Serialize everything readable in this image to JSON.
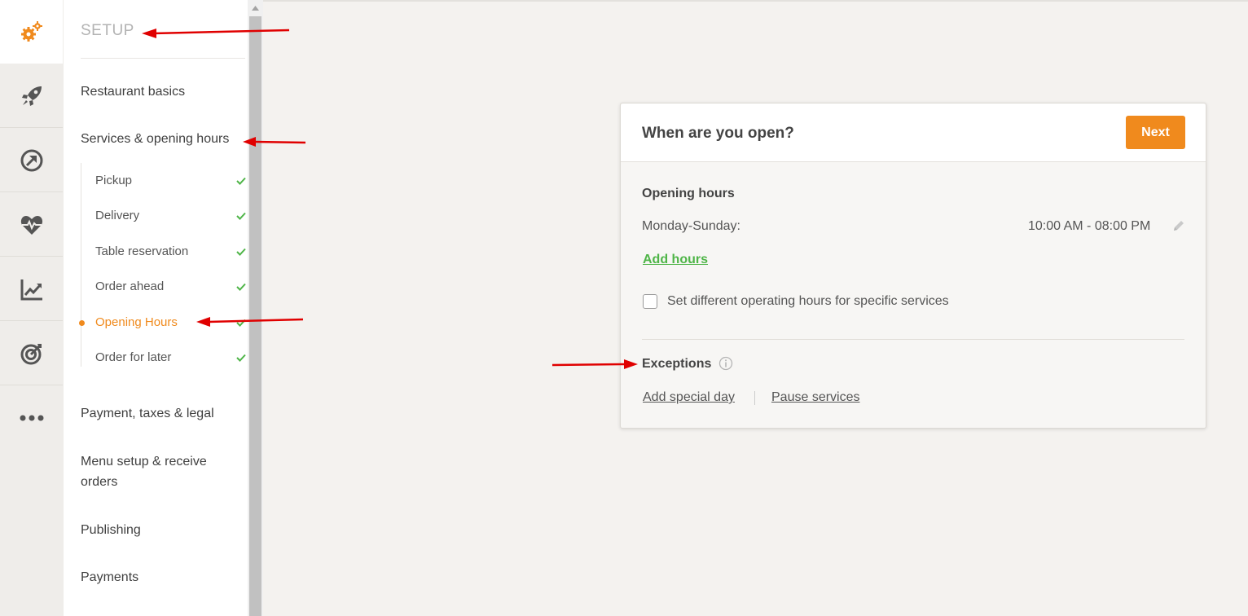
{
  "rail": {
    "items": [
      {
        "icon": "gears-icon",
        "active": true
      },
      {
        "icon": "rocket-icon"
      },
      {
        "icon": "promote-arrow-icon"
      },
      {
        "icon": "health-heart-icon"
      },
      {
        "icon": "chart-line-icon"
      },
      {
        "icon": "target-icon"
      },
      {
        "icon": "more-dots-icon"
      }
    ]
  },
  "sidebar": {
    "title": "SETUP",
    "items": [
      {
        "label": "Restaurant basics"
      },
      {
        "label": "Services & opening hours"
      },
      {
        "label": "Payment, taxes & legal"
      },
      {
        "label": "Menu setup & receive orders"
      },
      {
        "label": "Publishing"
      },
      {
        "label": "Payments"
      }
    ],
    "subitems": [
      {
        "label": "Pickup",
        "done": true
      },
      {
        "label": "Delivery",
        "done": true
      },
      {
        "label": "Table reservation",
        "done": true
      },
      {
        "label": "Order ahead",
        "done": true
      },
      {
        "label": "Opening Hours",
        "current": true,
        "done": true
      },
      {
        "label": "Order for later",
        "done": true
      }
    ]
  },
  "card": {
    "title": "When are you open?",
    "next_label": "Next",
    "opening_hours": {
      "title": "Opening hours",
      "row_label": "Monday-Sunday:",
      "row_value": "10:00 AM - 08:00 PM",
      "add_hours": "Add hours",
      "checkbox_label": "Set different operating hours for specific services",
      "checkbox_checked": false
    },
    "exceptions": {
      "title": "Exceptions",
      "add_special_day": "Add special day",
      "pause_services": "Pause services"
    }
  },
  "colors": {
    "accent_orange": "#f08a1d",
    "link_green": "#4fb548",
    "check_green": "#4fb548",
    "annotation_red": "#e00000"
  }
}
